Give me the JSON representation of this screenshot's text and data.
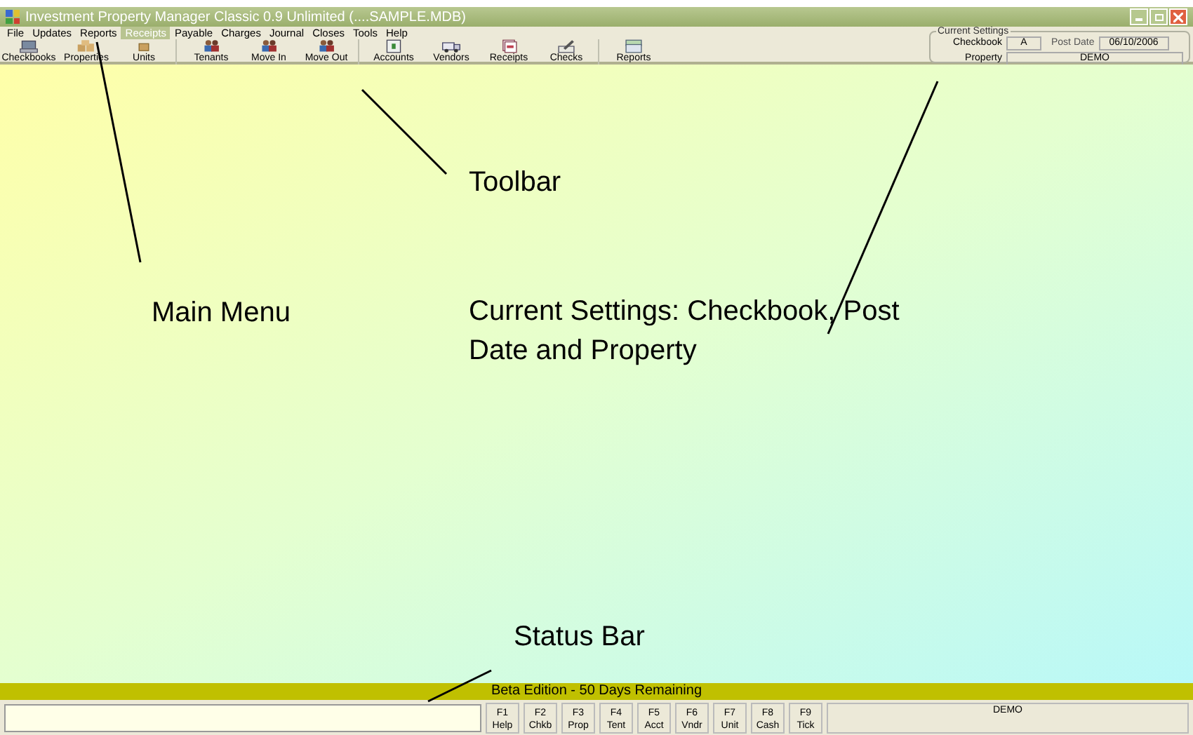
{
  "window": {
    "title": "Investment Property Manager Classic 0.9 Unlimited (....SAMPLE.MDB)"
  },
  "menu": [
    {
      "label": "File",
      "selected": false
    },
    {
      "label": "Updates",
      "selected": false
    },
    {
      "label": "Reports",
      "selected": false
    },
    {
      "label": "Receipts",
      "selected": true
    },
    {
      "label": "Payable",
      "selected": false
    },
    {
      "label": "Charges",
      "selected": false
    },
    {
      "label": "Journal",
      "selected": false
    },
    {
      "label": "Closes",
      "selected": false
    },
    {
      "label": "Tools",
      "selected": false
    },
    {
      "label": "Help",
      "selected": false
    }
  ],
  "toolbar": [
    {
      "label": "Checkbooks",
      "kind": "laptop",
      "separator_before": false
    },
    {
      "label": "Properties",
      "kind": "boxes",
      "separator_before": false
    },
    {
      "label": "Units",
      "kind": "box",
      "separator_before": false
    },
    {
      "label": "Tenants",
      "kind": "people",
      "separator_before": true
    },
    {
      "label": "Move In",
      "kind": "people",
      "separator_before": false
    },
    {
      "label": "Move Out",
      "kind": "people",
      "separator_before": false
    },
    {
      "label": "Accounts",
      "kind": "ledger",
      "separator_before": true
    },
    {
      "label": "Vendors",
      "kind": "truck",
      "separator_before": false
    },
    {
      "label": "Receipts",
      "kind": "papers",
      "separator_before": false
    },
    {
      "label": "Checks",
      "kind": "pen",
      "separator_before": false
    },
    {
      "label": "Reports",
      "kind": "report",
      "separator_before": true
    }
  ],
  "current_settings": {
    "title": "Current Settings",
    "checkbook_label": "Checkbook",
    "checkbook": "A",
    "post_date_label": "Post Date",
    "post_date": "06/10/2006",
    "property_label": "Property",
    "property": "DEMO"
  },
  "annotations": [
    {
      "text": "Main Menu"
    },
    {
      "text": "Toolbar"
    },
    {
      "text": "Current Settings: Checkbook, Post Date and Property"
    },
    {
      "text": "Status Bar"
    }
  ],
  "banner": "Beta Edition - 50 Days Remaining",
  "function_keys": [
    {
      "key": "F1",
      "label": "Help"
    },
    {
      "key": "F2",
      "label": "Chkb"
    },
    {
      "key": "F3",
      "label": "Prop"
    },
    {
      "key": "F4",
      "label": "Tent"
    },
    {
      "key": "F5",
      "label": "Acct"
    },
    {
      "key": "F6",
      "label": "Vndr"
    },
    {
      "key": "F7",
      "label": "Unit"
    },
    {
      "key": "F8",
      "label": "Cash"
    },
    {
      "key": "F9",
      "label": "Tick"
    }
  ],
  "status_property": "DEMO"
}
